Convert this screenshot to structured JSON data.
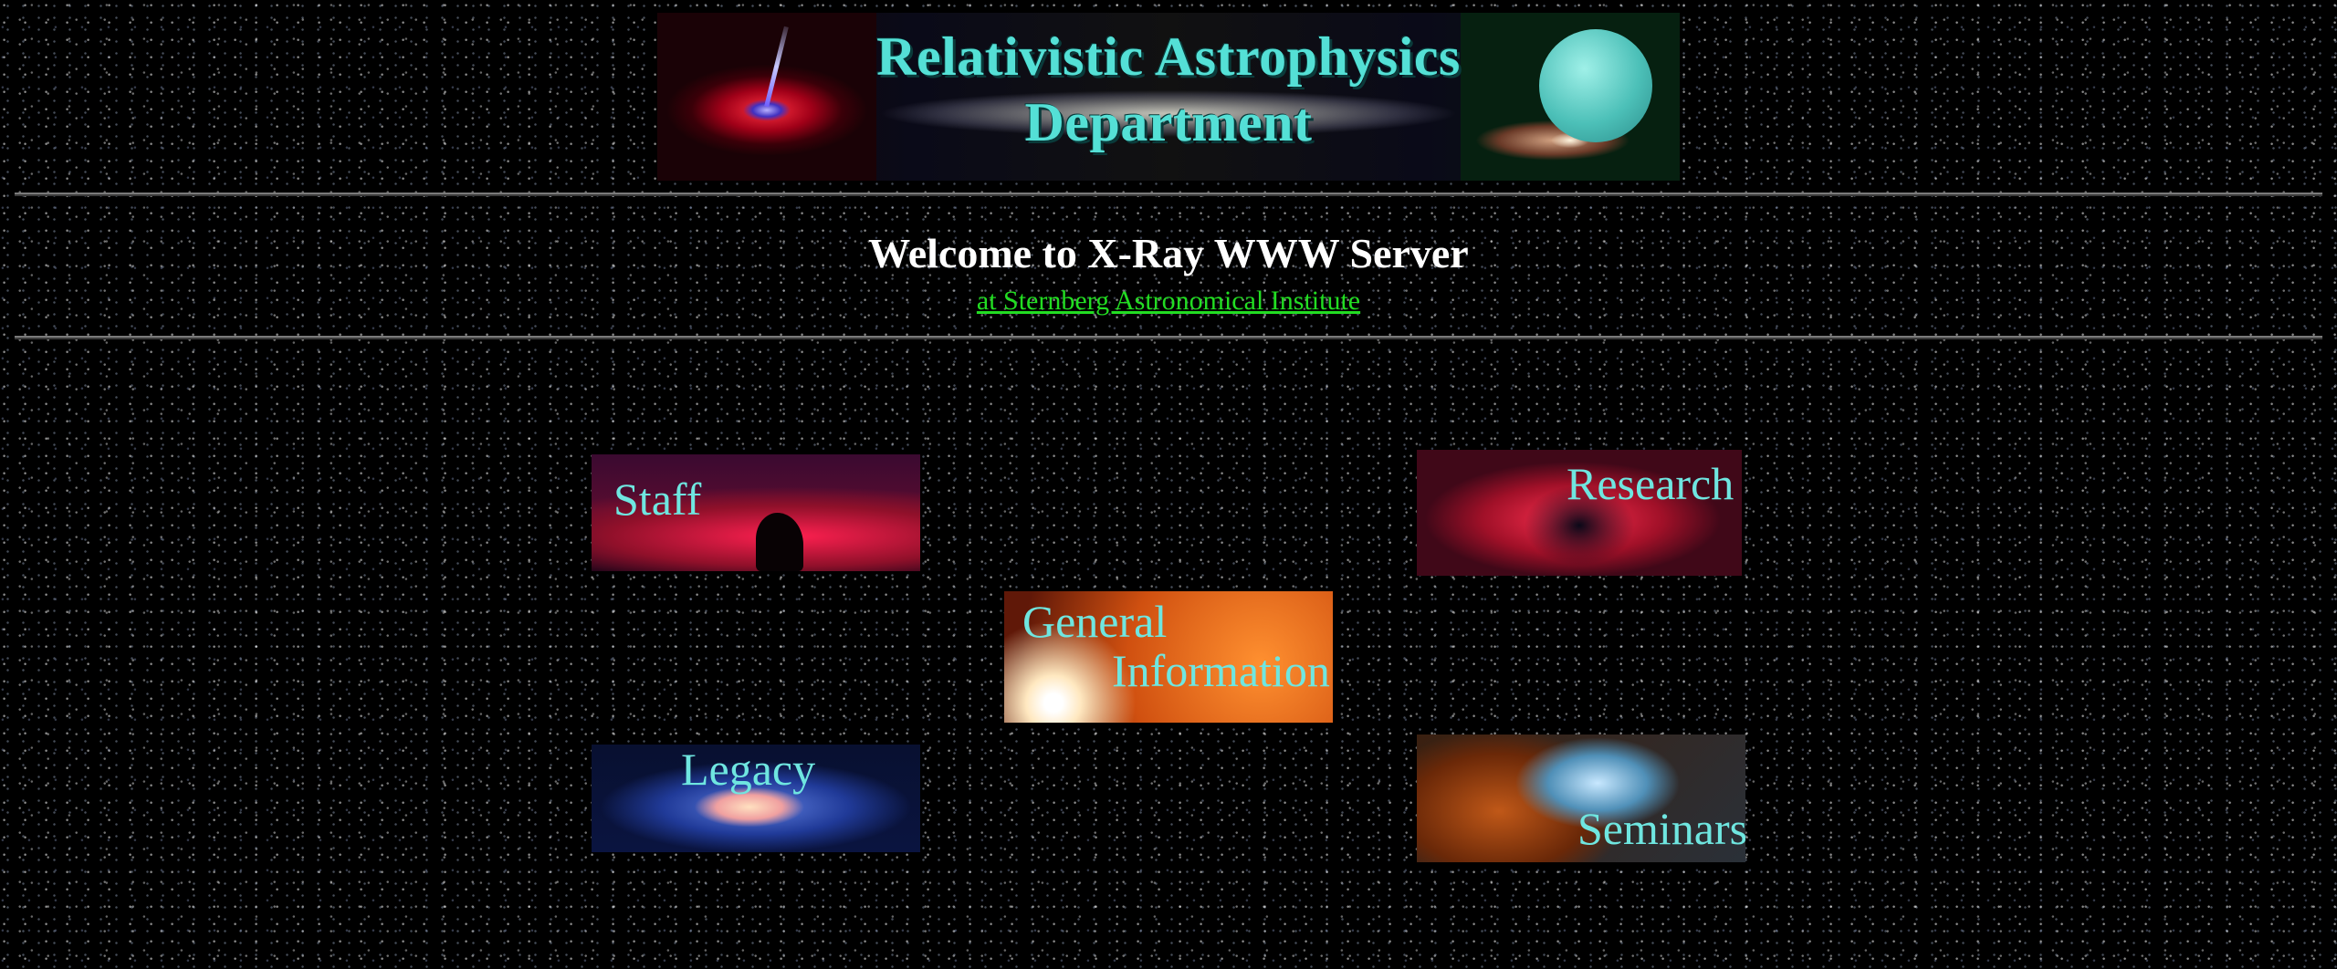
{
  "header": {
    "banner_title_line1": "Relativistic Astrophysics",
    "banner_title_line2": "Department"
  },
  "welcome": {
    "heading": "Welcome to X-Ray WWW Server",
    "institute_link": "at Sternberg Astronomical Institute"
  },
  "nav": {
    "staff": "Staff",
    "research": "Research",
    "general_line1": "General",
    "general_line2": "Information",
    "legacy": "Legacy",
    "seminars": "Seminars"
  },
  "colors": {
    "background": "#000000",
    "title_teal": "#54e0d6",
    "link_green": "#22dd22",
    "tile_label": "#6fe6e0"
  }
}
